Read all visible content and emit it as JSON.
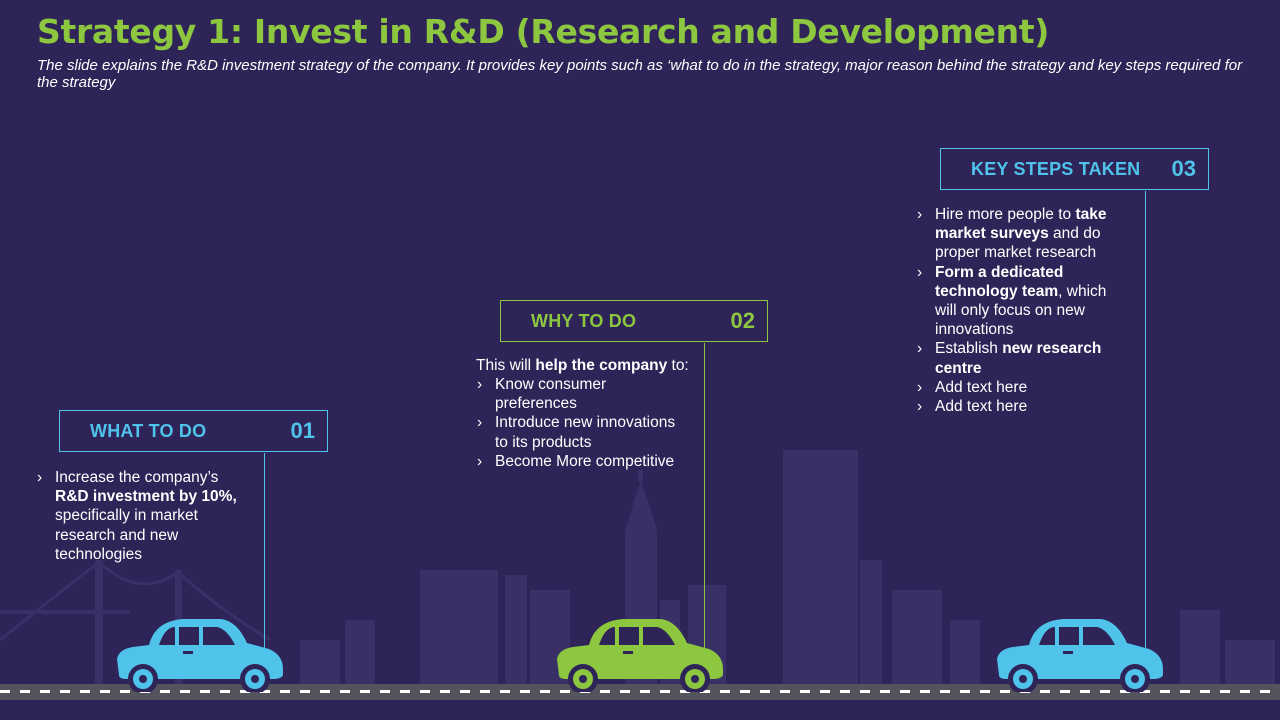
{
  "header": {
    "title": "Strategy 1: Invest in R&D (Research and Development)",
    "subtitle": "The slide explains the R&D investment strategy of the company. It provides key points such as ‘what to do in the strategy, major reason behind the strategy and key steps required for the strategy"
  },
  "colors": {
    "background": "#2e2457",
    "green": "#8dc63f",
    "blue": "#4fc3ea",
    "skyline": "#3a3068",
    "road": "#54545c"
  },
  "steps": [
    {
      "label": "WHAT TO DO",
      "number": "01",
      "bullets": [
        {
          "parts": [
            {
              "text": "Increase the company’s ",
              "bold": false
            },
            {
              "text": "R&D investment by 10%,",
              "bold": true
            },
            {
              "text": " specifically in market research and new technologies",
              "bold": false
            }
          ]
        }
      ]
    },
    {
      "label": "WHY TO DO",
      "number": "02",
      "intro": {
        "pre": "This will ",
        "bold": "help the company",
        "post": " to:"
      },
      "bullets": [
        {
          "parts": [
            {
              "text": "Know consumer preferences",
              "bold": false
            }
          ]
        },
        {
          "parts": [
            {
              "text": "Introduce  new innovations to its products",
              "bold": false
            }
          ]
        },
        {
          "parts": [
            {
              "text": "Become More competitive",
              "bold": false
            }
          ]
        }
      ]
    },
    {
      "label": "KEY STEPS TAKEN",
      "number": "03",
      "bullets": [
        {
          "parts": [
            {
              "text": "Hire more people to ",
              "bold": false
            },
            {
              "text": "take market surveys",
              "bold": true
            },
            {
              "text": " and do proper market research",
              "bold": false
            }
          ]
        },
        {
          "parts": [
            {
              "text": "Form a dedicated technology team",
              "bold": true
            },
            {
              "text": ", which will only focus on new innovations",
              "bold": false
            }
          ]
        },
        {
          "parts": [
            {
              "text": "Establish ",
              "bold": false
            },
            {
              "text": "new research centre",
              "bold": true
            }
          ]
        },
        {
          "parts": [
            {
              "text": "Add text here",
              "bold": false
            }
          ]
        },
        {
          "parts": [
            {
              "text": "Add text here",
              "bold": false
            }
          ]
        }
      ]
    }
  ],
  "cars": [
    {
      "color": "#4fc3ea"
    },
    {
      "color": "#8dc63f"
    },
    {
      "color": "#4fc3ea"
    }
  ]
}
